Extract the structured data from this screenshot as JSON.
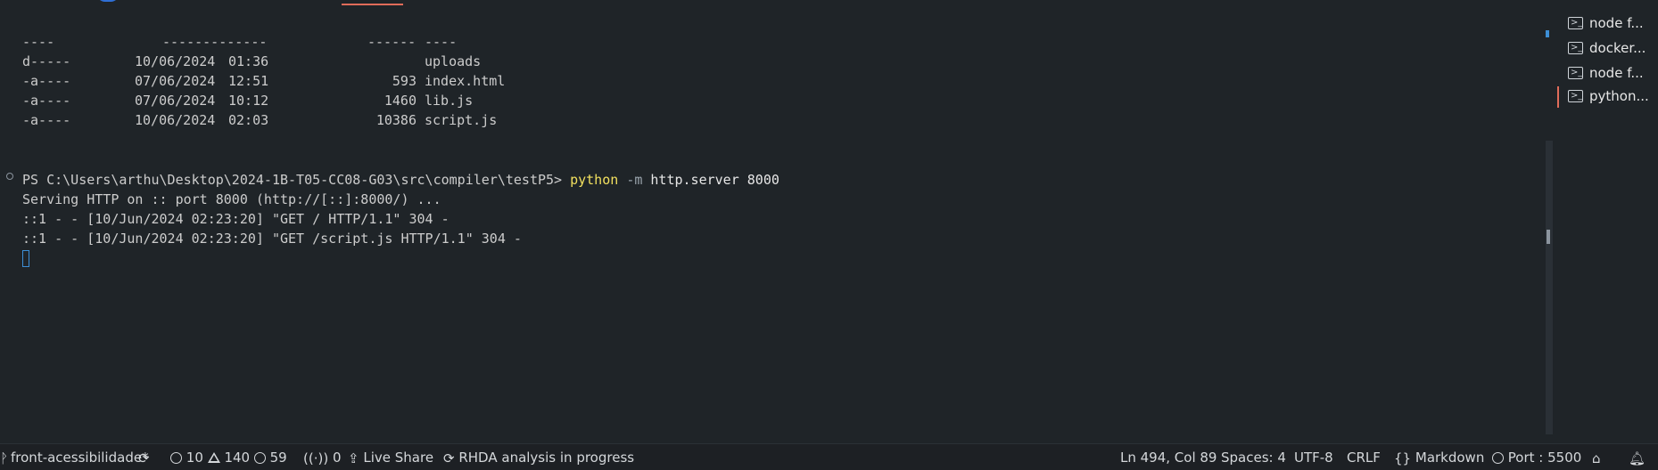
{
  "terminal": {
    "header": {
      "mode": "----",
      "date_time": "-------------",
      "length": "------",
      "name": "----"
    },
    "entries": [
      {
        "mode": "d-----",
        "date": "10/06/2024",
        "time": "01:36",
        "length": "",
        "name": "uploads"
      },
      {
        "mode": "-a----",
        "date": "07/06/2024",
        "time": "12:51",
        "length": "593",
        "name": "index.html"
      },
      {
        "mode": "-a----",
        "date": "07/06/2024",
        "time": "10:12",
        "length": "1460",
        "name": "lib.js"
      },
      {
        "mode": "-a----",
        "date": "10/06/2024",
        "time": "02:03",
        "length": "10386",
        "name": "script.js"
      }
    ],
    "prompt": "PS C:\\Users\\arthu\\Desktop\\2024-1B-T05-CC08-G03\\src\\compiler\\testP5> ",
    "command": {
      "program": "python",
      "flag": "-m",
      "args": "http.server 8000"
    },
    "output": [
      "Serving HTTP on :: port 8000 (http://[::]:8000/) ...",
      "::1 - - [10/Jun/2024 02:23:20] \"GET / HTTP/1.1\" 304 -",
      "::1 - - [10/Jun/2024 02:23:20] \"GET /script.js HTTP/1.1\" 304 -"
    ]
  },
  "terminal_list": [
    {
      "label": "node f...",
      "icon": "terminal-icon"
    },
    {
      "label": "docker...",
      "icon": "terminal-icon"
    },
    {
      "label": "node f...",
      "icon": "terminal-icon"
    },
    {
      "label": "python...",
      "icon": "terminal-icon"
    }
  ],
  "statusbar": {
    "branch": "front-acessibilidade*",
    "errors": "10",
    "warnings": "140",
    "infos": "59",
    "ports": "0",
    "live_share": "Live Share",
    "rhda": "RHDA analysis in progress",
    "position": "Ln 494, Col 89",
    "spaces": "Spaces: 4",
    "encoding": "UTF-8",
    "eol": "CRLF",
    "language": "Markdown",
    "port": "Port : 5500"
  },
  "colors": {
    "background": "#1f2428",
    "python_keyword": "#f2e05f",
    "cursor": "#3d8fd6",
    "active_tab_accent": "#e06c5a"
  }
}
